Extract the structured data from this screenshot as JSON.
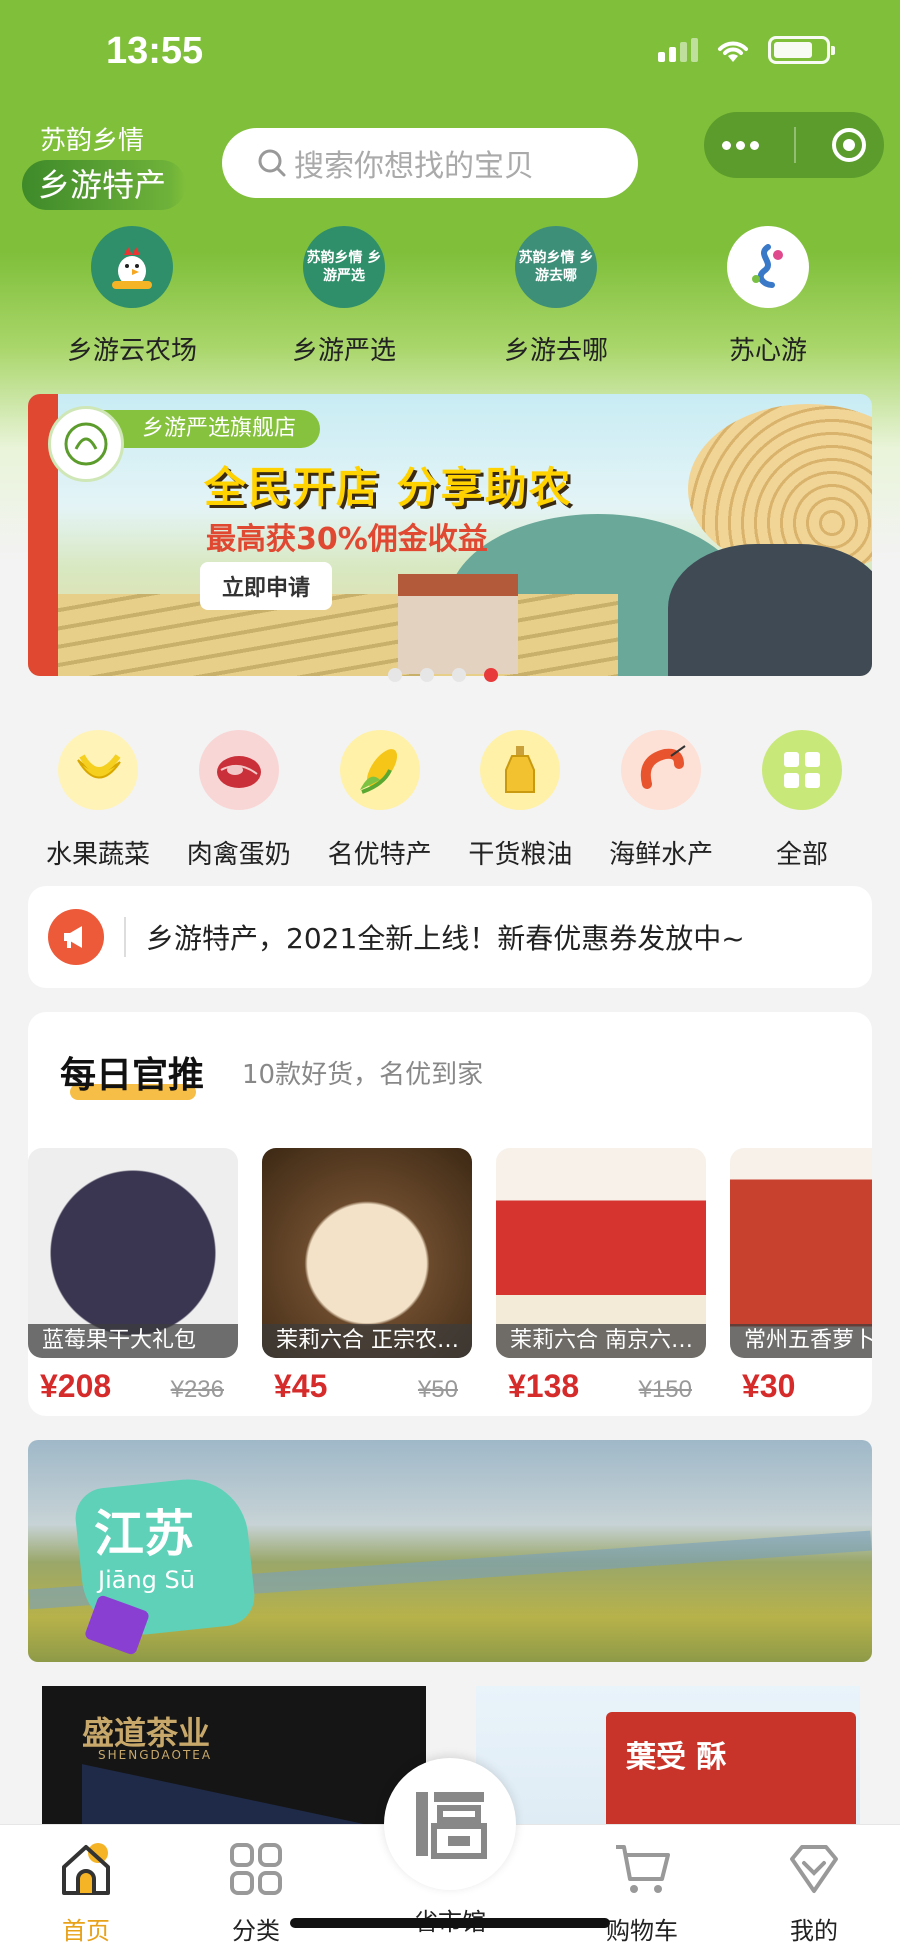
{
  "status_bar": {
    "time": "13:55"
  },
  "header": {
    "brand_small": "苏韵乡情",
    "brand_main": "乡游特产",
    "search_placeholder": "搜索你想找的宝贝"
  },
  "top_nav": [
    {
      "label": "乡游云农场",
      "logo_text": "乡游云农场",
      "color": "#2f8f6a"
    },
    {
      "label": "乡游严选",
      "logo_text": "苏韵乡情 乡游严选",
      "color": "#2f8f6a"
    },
    {
      "label": "乡游去哪",
      "logo_text": "苏韵乡情 乡游去哪",
      "color": "#2f8f6a"
    },
    {
      "label": "苏心游",
      "logo_text": "苏心游",
      "color": "#ffffff"
    }
  ],
  "banner": {
    "tag": "乡游严选旗舰店",
    "title": "全民开店 分享助农",
    "subtitle": "最高获30%佣金收益",
    "button": "立即申请",
    "pager_active_index": 3
  },
  "categories": [
    {
      "label": "水果蔬菜",
      "icon": "banana-icon",
      "bg": "#fff3b8"
    },
    {
      "label": "肉禽蛋奶",
      "icon": "steak-icon",
      "bg": "#f9d6d6"
    },
    {
      "label": "名优特产",
      "icon": "corn-icon",
      "bg": "#fff1a8"
    },
    {
      "label": "干货粮油",
      "icon": "oil-bottle-icon",
      "bg": "#fff1a8"
    },
    {
      "label": "海鲜水产",
      "icon": "shrimp-icon",
      "bg": "#fde0d6"
    },
    {
      "label": "全部",
      "icon": "grid-icon",
      "bg": "#c9e87a"
    }
  ],
  "notice": {
    "text": "乡游特产，2021全新上线！新春优惠券发放中~"
  },
  "daily": {
    "title": "每日官推",
    "subtitle": "10款好货，名优到家",
    "products": [
      {
        "name": "蓝莓果干大礼包",
        "price": "¥208",
        "old_price": "¥236",
        "color": "#2b2a3a"
      },
      {
        "name": "茉莉六合 正宗农…",
        "price": "¥45",
        "old_price": "¥50",
        "color": "#7a5a3c"
      },
      {
        "name": "茉莉六合 南京六…",
        "price": "¥138",
        "old_price": "¥150",
        "color": "#d6342e"
      },
      {
        "name": "常州五香萝卜干",
        "price": "¥30",
        "old_price": "",
        "color": "#c8402e"
      }
    ]
  },
  "jiangsu_banner": {
    "title": "江苏",
    "pinyin": "Jiāng Sū"
  },
  "promos": {
    "left": {
      "brand": "盛道茶业",
      "brand_en": "SHENGDAOTEA"
    },
    "right": {
      "text": "葉受 酥"
    }
  },
  "tab_bar": {
    "tabs": [
      {
        "label": "首页",
        "icon": "home-icon"
      },
      {
        "label": "分类",
        "icon": "grid-icon"
      },
      {
        "label": "省市馆",
        "icon": "pavilion-icon"
      },
      {
        "label": "购物车",
        "icon": "cart-icon"
      },
      {
        "label": "我的",
        "icon": "profile-icon"
      }
    ],
    "active_index": 0
  }
}
